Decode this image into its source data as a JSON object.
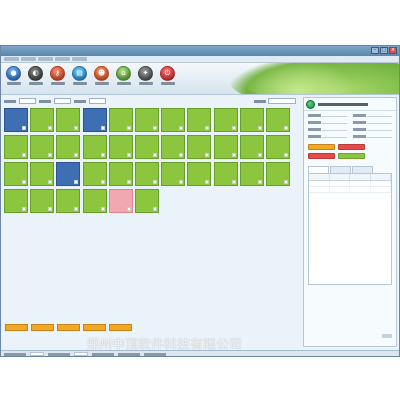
{
  "window": {
    "title": ""
  },
  "menu": {
    "items": [
      "",
      "",
      "",
      "",
      ""
    ]
  },
  "toolbar": {
    "buttons": [
      {
        "label": "",
        "icon": "user-icon"
      },
      {
        "label": "",
        "icon": "person-icon"
      },
      {
        "label": "",
        "icon": "key-icon"
      },
      {
        "label": "",
        "icon": "document-icon"
      },
      {
        "label": "",
        "icon": "people-icon"
      },
      {
        "label": "",
        "icon": "house-icon"
      },
      {
        "label": "",
        "icon": "settings-icon"
      },
      {
        "label": "",
        "icon": "power-icon"
      }
    ]
  },
  "filters": {
    "building_value": "",
    "floor_value": "",
    "room_type_value": "",
    "search_value": ""
  },
  "rooms": [
    {
      "number": "",
      "status": "",
      "state": "blue"
    },
    {
      "number": "",
      "status": "",
      "state": "green"
    },
    {
      "number": "",
      "status": "",
      "state": "green"
    },
    {
      "number": "",
      "status": "",
      "state": "blue"
    },
    {
      "number": "",
      "status": "",
      "state": "green"
    },
    {
      "number": "",
      "status": "",
      "state": "green"
    },
    {
      "number": "",
      "status": "",
      "state": "green"
    },
    {
      "number": "",
      "status": "",
      "state": "green"
    },
    {
      "number": "",
      "status": "",
      "state": "green"
    },
    {
      "number": "",
      "status": "",
      "state": "green"
    },
    {
      "number": "",
      "status": "",
      "state": "green"
    },
    {
      "number": "",
      "status": "",
      "state": "green"
    },
    {
      "number": "",
      "status": "",
      "state": "green"
    },
    {
      "number": "",
      "status": "",
      "state": "green"
    },
    {
      "number": "",
      "status": "",
      "state": "green"
    },
    {
      "number": "",
      "status": "",
      "state": "green"
    },
    {
      "number": "",
      "status": "",
      "state": "green"
    },
    {
      "number": "",
      "status": "",
      "state": "green"
    },
    {
      "number": "",
      "status": "",
      "state": "green"
    },
    {
      "number": "",
      "status": "",
      "state": "green"
    },
    {
      "number": "",
      "status": "",
      "state": "green"
    },
    {
      "number": "",
      "status": "",
      "state": "green"
    },
    {
      "number": "",
      "status": "",
      "state": "green"
    },
    {
      "number": "",
      "status": "",
      "state": "green"
    },
    {
      "number": "",
      "status": "",
      "state": "blue"
    },
    {
      "number": "",
      "status": "",
      "state": "green"
    },
    {
      "number": "",
      "status": "",
      "state": "green"
    },
    {
      "number": "",
      "status": "",
      "state": "green"
    },
    {
      "number": "",
      "status": "",
      "state": "green"
    },
    {
      "number": "",
      "status": "",
      "state": "green"
    },
    {
      "number": "",
      "status": "",
      "state": "green"
    },
    {
      "number": "",
      "status": "",
      "state": "green"
    },
    {
      "number": "",
      "status": "",
      "state": "green"
    },
    {
      "number": "",
      "status": "",
      "state": "green"
    },
    {
      "number": "",
      "status": "",
      "state": "green"
    },
    {
      "number": "",
      "status": "",
      "state": "green"
    },
    {
      "number": "",
      "status": "",
      "state": "green"
    },
    {
      "number": "",
      "status": "",
      "state": "pink"
    },
    {
      "number": "",
      "status": "",
      "state": "green"
    }
  ],
  "legend": [
    {
      "label": "",
      "color": "#f5a623"
    },
    {
      "label": "",
      "color": "#f5a623"
    },
    {
      "label": "",
      "color": "#f5a623"
    },
    {
      "label": "",
      "color": "#f5a623"
    },
    {
      "label": "",
      "color": "#f5a623"
    }
  ],
  "right_panel": {
    "title": "",
    "fields": [
      {
        "label": "",
        "value": ""
      },
      {
        "label": "",
        "value": ""
      },
      {
        "label": "",
        "value": ""
      },
      {
        "label": "",
        "value": ""
      },
      {
        "label": "",
        "value": ""
      },
      {
        "label": "",
        "value": ""
      },
      {
        "label": "",
        "value": ""
      },
      {
        "label": "",
        "value": ""
      }
    ],
    "buttons": [
      {
        "label": "",
        "color": "#f5a623"
      },
      {
        "label": "",
        "color": "#e84a4a"
      },
      {
        "label": "",
        "color": "#e84a4a"
      },
      {
        "label": "",
        "color": "#8cc63f"
      }
    ],
    "tabs": [
      "",
      "",
      ""
    ],
    "table_headers": [
      "",
      "",
      "",
      ""
    ]
  },
  "status_bar": {
    "items": [
      "",
      "",
      "",
      "",
      ""
    ]
  },
  "watermark": "郑州中顶软件科技有限公司",
  "colors": {
    "room_vacant": "#8cc63f",
    "room_occupied": "#3e6fb3",
    "room_reserved": "#f2a8b0",
    "accent": "#6fb13c"
  }
}
